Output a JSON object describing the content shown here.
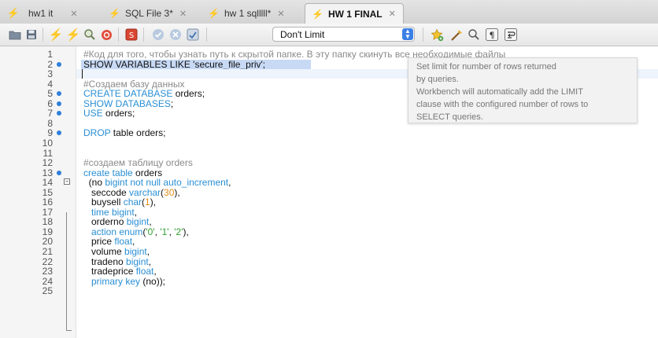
{
  "tabs": [
    {
      "label": "hw1 it",
      "active": false
    },
    {
      "label": "SQL File 3*",
      "active": false
    },
    {
      "label": "hw 1 sqlllll*",
      "active": false
    },
    {
      "label": "HW 1 FINAL",
      "active": true
    }
  ],
  "toolbar": {
    "limit_value": "Don't Limit"
  },
  "tooltip": {
    "lines": [
      "Set limit for number of rows returned",
      "by queries.",
      "Workbench will automatically add the LIMIT",
      "clause with the configured number of rows to",
      "SELECT queries."
    ]
  },
  "editor": {
    "lines": [
      {
        "n": "1",
        "dot": false,
        "tokens": [
          {
            "t": "#Код для того, чтобы узнать путь к скрытой папке. В эту папку скинуть все необходимые файлы",
            "c": "cm"
          }
        ]
      },
      {
        "n": "2",
        "dot": true,
        "selected": true,
        "tokens": [
          {
            "t": "SHOW VARIABLES LIKE 'secure_file_priv';",
            "c": "id"
          }
        ]
      },
      {
        "n": "3",
        "dot": false,
        "current": true,
        "tokens": []
      },
      {
        "n": "4",
        "dot": false,
        "tokens": [
          {
            "t": "#Создаем базу данных",
            "c": "cm"
          }
        ]
      },
      {
        "n": "5",
        "dot": true,
        "tokens": [
          {
            "t": "CREATE DATABASE",
            "c": "kw"
          },
          {
            "t": " orders;",
            "c": "id"
          }
        ]
      },
      {
        "n": "6",
        "dot": true,
        "tokens": [
          {
            "t": "SHOW DATABASES",
            "c": "kw"
          },
          {
            "t": ";",
            "c": "id"
          }
        ]
      },
      {
        "n": "7",
        "dot": true,
        "tokens": [
          {
            "t": "USE",
            "c": "kw"
          },
          {
            "t": " orders;",
            "c": "id"
          }
        ]
      },
      {
        "n": "8",
        "dot": false,
        "tokens": []
      },
      {
        "n": "9",
        "dot": true,
        "tokens": [
          {
            "t": "DROP",
            "c": "kw"
          },
          {
            "t": " table orders;",
            "c": "id"
          }
        ]
      },
      {
        "n": "10",
        "dot": false,
        "tokens": []
      },
      {
        "n": "11",
        "dot": false,
        "tokens": []
      },
      {
        "n": "12",
        "dot": false,
        "tokens": [
          {
            "t": "#создаем таблицу orders",
            "c": "cm"
          }
        ]
      },
      {
        "n": "13",
        "dot": true,
        "tokens": [
          {
            "t": "create table",
            "c": "kw"
          },
          {
            "t": " orders",
            "c": "id"
          }
        ]
      },
      {
        "n": "14",
        "dot": false,
        "fold": true,
        "tokens": [
          {
            "t": "  (no ",
            "c": "id"
          },
          {
            "t": "bigint not null auto_increment",
            "c": "kw"
          },
          {
            "t": ",",
            "c": "id"
          }
        ]
      },
      {
        "n": "15",
        "dot": false,
        "tokens": [
          {
            "t": "   seccode ",
            "c": "id"
          },
          {
            "t": "varchar",
            "c": "kw"
          },
          {
            "t": "(",
            "c": "id"
          },
          {
            "t": "30",
            "c": "nm"
          },
          {
            "t": "),",
            "c": "id"
          }
        ]
      },
      {
        "n": "16",
        "dot": false,
        "tokens": [
          {
            "t": "   buysell ",
            "c": "id"
          },
          {
            "t": "char",
            "c": "kw"
          },
          {
            "t": "(",
            "c": "id"
          },
          {
            "t": "1",
            "c": "nm"
          },
          {
            "t": "),",
            "c": "id"
          }
        ]
      },
      {
        "n": "17",
        "dot": false,
        "tokens": [
          {
            "t": "   time bigint",
            "c": "kw"
          },
          {
            "t": ",",
            "c": "id"
          }
        ]
      },
      {
        "n": "18",
        "dot": false,
        "tokens": [
          {
            "t": "   orderno ",
            "c": "id"
          },
          {
            "t": "bigint",
            "c": "kw"
          },
          {
            "t": ",",
            "c": "id"
          }
        ]
      },
      {
        "n": "19",
        "dot": false,
        "tokens": [
          {
            "t": "   action enum",
            "c": "kw"
          },
          {
            "t": "(",
            "c": "id"
          },
          {
            "t": "'0'",
            "c": "st"
          },
          {
            "t": ", ",
            "c": "id"
          },
          {
            "t": "'1'",
            "c": "st"
          },
          {
            "t": ", ",
            "c": "id"
          },
          {
            "t": "'2'",
            "c": "st"
          },
          {
            "t": "),",
            "c": "id"
          }
        ]
      },
      {
        "n": "20",
        "dot": false,
        "tokens": [
          {
            "t": "   price ",
            "c": "id"
          },
          {
            "t": "float",
            "c": "kw"
          },
          {
            "t": ",",
            "c": "id"
          }
        ]
      },
      {
        "n": "21",
        "dot": false,
        "tokens": [
          {
            "t": "   volume ",
            "c": "id"
          },
          {
            "t": "bigint",
            "c": "kw"
          },
          {
            "t": ",",
            "c": "id"
          }
        ]
      },
      {
        "n": "22",
        "dot": false,
        "tokens": [
          {
            "t": "   tradeno ",
            "c": "id"
          },
          {
            "t": "bigint",
            "c": "kw"
          },
          {
            "t": ",",
            "c": "id"
          }
        ]
      },
      {
        "n": "23",
        "dot": false,
        "tokens": [
          {
            "t": "   tradeprice ",
            "c": "id"
          },
          {
            "t": "float",
            "c": "kw"
          },
          {
            "t": ",",
            "c": "id"
          }
        ]
      },
      {
        "n": "24",
        "dot": false,
        "tokens": [
          {
            "t": "   primary key",
            "c": "kw"
          },
          {
            "t": " (no));",
            "c": "id"
          }
        ]
      },
      {
        "n": "25",
        "dot": false,
        "tokens": []
      }
    ]
  },
  "colors": {
    "keyword": "#2a8fd4",
    "comment": "#8a8a8a",
    "string": "#2e9e2e",
    "number": "#e28c19",
    "selection": "#c7d9f4",
    "statement_dot": "#2f7fd9"
  }
}
